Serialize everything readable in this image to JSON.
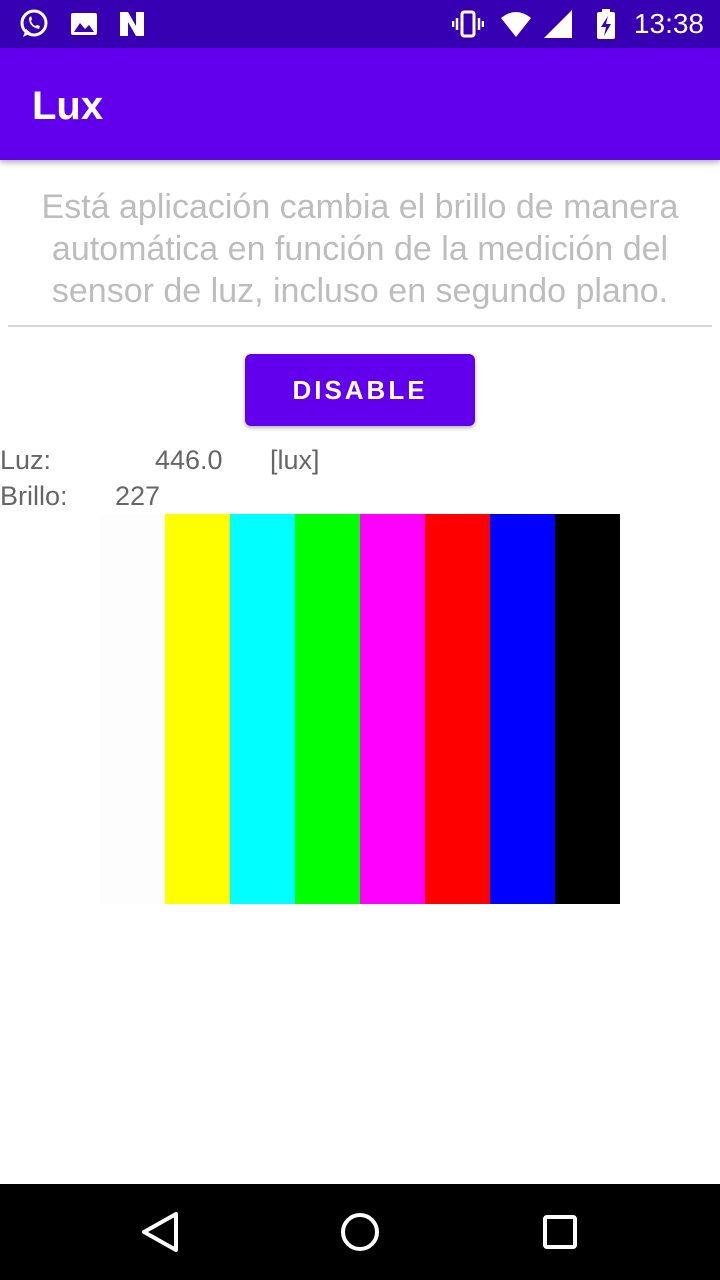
{
  "status_bar": {
    "time": "13:38",
    "left_icons": [
      "whatsapp-icon",
      "gallery-icon",
      "n-app-icon"
    ],
    "right_icons": [
      "vibrate-icon",
      "wifi-icon",
      "signal-icon",
      "battery-charging-icon"
    ]
  },
  "app_bar": {
    "title": "Lux",
    "color": "#6200ee"
  },
  "description": "Está aplicación cambia el brillo de manera automática en función de la medición del sensor de luz, incluso en segundo plano.",
  "toggle_button": {
    "label": "DISABLE"
  },
  "readings": {
    "light_label": "Luz:",
    "light_value": "446.0",
    "light_unit": "[lux]",
    "brightness_label": "Brillo:",
    "brightness_value": "227"
  },
  "color_bars": [
    {
      "name": "white",
      "color": "#fdfdfd"
    },
    {
      "name": "yellow",
      "color": "#ffff00"
    },
    {
      "name": "cyan",
      "color": "#00ffff"
    },
    {
      "name": "green",
      "color": "#00ff00"
    },
    {
      "name": "magenta",
      "color": "#ff00ff"
    },
    {
      "name": "red",
      "color": "#ff0000"
    },
    {
      "name": "blue",
      "color": "#0000ff"
    },
    {
      "name": "black",
      "color": "#000000"
    }
  ],
  "nav_bar": {
    "icons": [
      "back-icon",
      "home-icon",
      "recents-icon"
    ]
  }
}
